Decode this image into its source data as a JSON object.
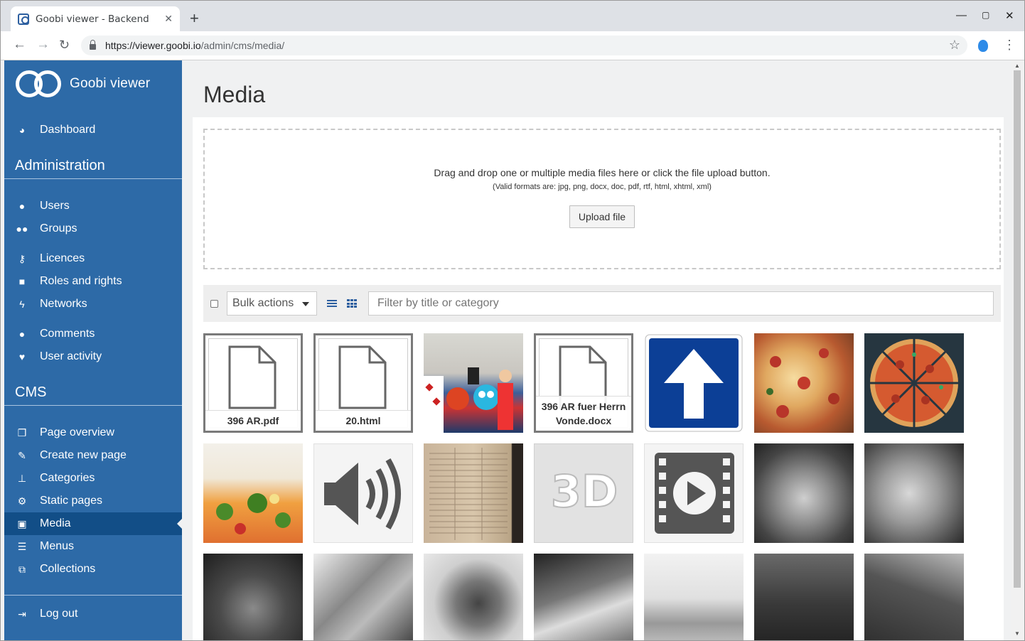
{
  "browser": {
    "tab_title": "Goobi viewer - Backend",
    "url_host": "https://viewer.goobi.io",
    "url_path": "/admin/cms/media/"
  },
  "brand": {
    "name": "Goobi viewer"
  },
  "sidebar": {
    "dashboard": "Dashboard",
    "admin_heading": "Administration",
    "admin_items": [
      {
        "label": "Users",
        "icon": "user-icon"
      },
      {
        "label": "Groups",
        "icon": "users-icon"
      },
      {
        "label": "Licences",
        "icon": "key-icon"
      },
      {
        "label": "Roles and rights",
        "icon": "lock-icon"
      },
      {
        "label": "Networks",
        "icon": "bolt-icon"
      },
      {
        "label": "Comments",
        "icon": "comments-icon"
      },
      {
        "label": "User activity",
        "icon": "heartbeat-icon"
      }
    ],
    "cms_heading": "CMS",
    "cms_items": [
      {
        "label": "Page overview",
        "icon": "files-icon"
      },
      {
        "label": "Create new page",
        "icon": "edit-icon"
      },
      {
        "label": "Categories",
        "icon": "thumbtack-icon"
      },
      {
        "label": "Static pages",
        "icon": "cogs-icon"
      },
      {
        "label": "Media",
        "icon": "image-icon",
        "active": true
      },
      {
        "label": "Menus",
        "icon": "bars-icon"
      },
      {
        "label": "Collections",
        "icon": "object-group-icon"
      }
    ],
    "logout": "Log out"
  },
  "main": {
    "title": "Media",
    "dropzone": {
      "text": "Drag and drop one or multiple media files here or click the file upload button.",
      "formats": "(Valid formats are: jpg, png, docx, doc, pdf, rtf, html, xhtml, xml)",
      "upload_label": "Upload file"
    },
    "filter": {
      "bulk_label": "Bulk actions",
      "placeholder": "Filter by title or category"
    },
    "media": [
      {
        "kind": "doc",
        "label": "396 AR.pdf"
      },
      {
        "kind": "doc",
        "label": "20.html"
      },
      {
        "kind": "photo",
        "name": "costume-group-photo"
      },
      {
        "kind": "doc",
        "label": "396 AR fuer Herrn Vonde.docx"
      },
      {
        "kind": "sign",
        "name": "one-way-sign-image"
      },
      {
        "kind": "photo",
        "name": "pizza-slice-photo"
      },
      {
        "kind": "photo",
        "name": "pizza-top-photo"
      },
      {
        "kind": "photo",
        "name": "vegetable-pizza-photo"
      },
      {
        "kind": "icon",
        "name": "audio-placeholder-image"
      },
      {
        "kind": "photo",
        "name": "old-newspaper-scan"
      },
      {
        "kind": "icon",
        "name": "3d-placeholder-image"
      },
      {
        "kind": "icon",
        "name": "video-placeholder-image"
      },
      {
        "kind": "photo",
        "name": "old-man-headscarf-photo"
      },
      {
        "kind": "photo",
        "name": "old-man-portrait-photo"
      },
      {
        "kind": "photo",
        "name": "man-hood-portrait-photo"
      },
      {
        "kind": "photo",
        "name": "children-street-photo"
      },
      {
        "kind": "photo",
        "name": "boy-portrait-photo"
      },
      {
        "kind": "photo",
        "name": "holding-hands-photo"
      },
      {
        "kind": "photo",
        "name": "woman-sunglasses-photo"
      },
      {
        "kind": "photo",
        "name": "sea-rowing-photo"
      },
      {
        "kind": "photo",
        "name": "hands-book-photo"
      }
    ]
  },
  "colors": {
    "sidebar": "#2d6aa7",
    "sidebar_active": "#124e87",
    "accent": "#2d5fa0"
  }
}
